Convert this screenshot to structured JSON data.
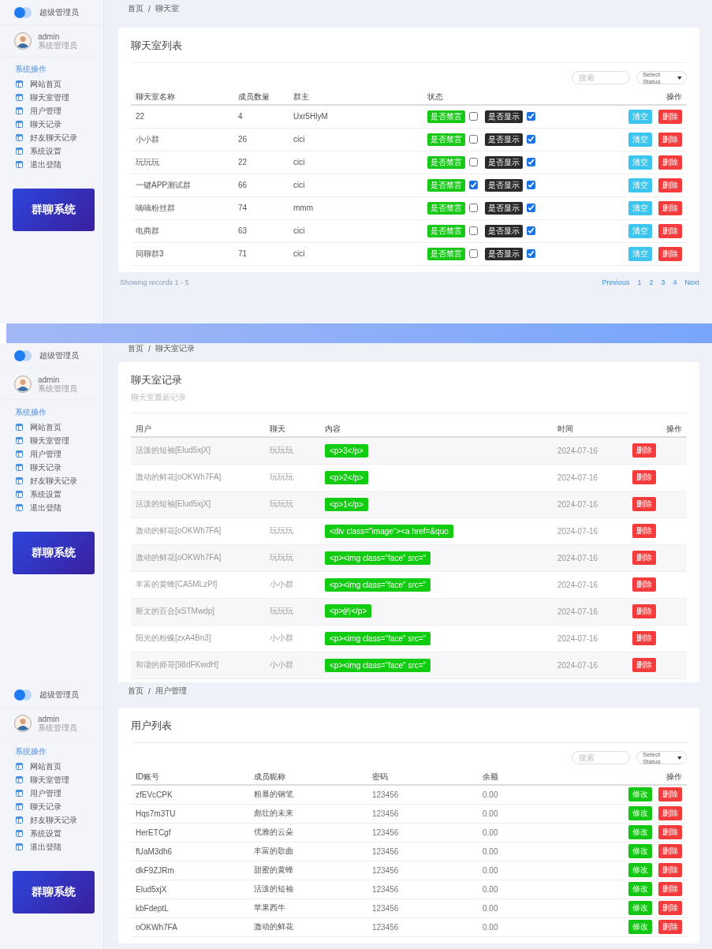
{
  "panels": [
    {
      "kind": "rooms",
      "sidebar": {
        "logo_text": "超级管理员",
        "user": {
          "name": "admin",
          "role": "系统管理员"
        },
        "section": "系统操作",
        "items": [
          "网站首页",
          "聊天室管理",
          "用户管理",
          "聊天记录",
          "好友聊天记录",
          "系统设置",
          "退出登陆"
        ],
        "banner": "群聊系统"
      },
      "breadcrumb": {
        "items": [
          "首页",
          "聊天室"
        ],
        "separator": "/"
      },
      "card": {
        "title": "聊天室列表",
        "search": {
          "placeholder": "搜索"
        },
        "select": {
          "value": "Select Status"
        },
        "columns": [
          "聊天室名称",
          "成员数量",
          "群主",
          "状态",
          "操作"
        ],
        "rows": [
          {
            "name": "22",
            "members": "4",
            "owner": "Uxr5HlyM",
            "mute_label": "是否禁言",
            "muted": false,
            "show_label": "是否显示",
            "visible": true,
            "actions": [
              "清空",
              "删除"
            ]
          },
          {
            "name": "小小群",
            "members": "26",
            "owner": "cici",
            "mute_label": "是否禁言",
            "muted": false,
            "show_label": "是否显示",
            "visible": true,
            "actions": [
              "清空",
              "删除"
            ]
          },
          {
            "name": "玩玩玩",
            "members": "22",
            "owner": "cici",
            "mute_label": "是否禁言",
            "muted": false,
            "show_label": "是否显示",
            "visible": true,
            "actions": [
              "清空",
              "删除"
            ]
          },
          {
            "name": "一键APP测试群",
            "members": "66",
            "owner": "cici",
            "mute_label": "是否禁言",
            "muted": true,
            "show_label": "是否显示",
            "visible": true,
            "actions": [
              "清空",
              "删除"
            ]
          },
          {
            "name": "嘀嘀粉丝群",
            "members": "74",
            "owner": "mmm",
            "mute_label": "是否禁言",
            "muted": false,
            "show_label": "是否显示",
            "visible": true,
            "actions": [
              "清空",
              "删除"
            ]
          },
          {
            "name": "电商群",
            "members": "63",
            "owner": "cici",
            "mute_label": "是否禁言",
            "muted": false,
            "show_label": "是否显示",
            "visible": true,
            "actions": [
              "清空",
              "删除"
            ]
          },
          {
            "name": "同聊群3",
            "members": "71",
            "owner": "cici",
            "mute_label": "是否禁言",
            "muted": false,
            "show_label": "是否显示",
            "visible": true,
            "actions": [
              "清空",
              "删除"
            ]
          }
        ]
      },
      "footer": {
        "records": "Showing records 1 - 5",
        "pagination": [
          "Previous",
          "1",
          "2",
          "3",
          "4",
          "Next"
        ]
      }
    },
    {
      "kind": "records",
      "sidebar": {
        "logo_text": "超级管理员",
        "user": {
          "name": "admin",
          "role": "系统管理员"
        },
        "section": "系统操作",
        "items": [
          "网站首页",
          "聊天室管理",
          "用户管理",
          "聊天记录",
          "好友聊天记录",
          "系统设置",
          "退出登陆"
        ],
        "banner": "群聊系统"
      },
      "breadcrumb": {
        "items": [
          "首页",
          "聊天室记录"
        ],
        "separator": "/"
      },
      "card": {
        "title": "聊天室记录",
        "subtitle": "聊天室最新记录",
        "columns": [
          "用户",
          "聊天",
          "内容",
          "时间",
          "操作"
        ],
        "rows": [
          {
            "user": "活泼的短袖[Elud5xjX]",
            "room": "玩玩玩",
            "content": "<p>3</p>",
            "time": "2024-07-16",
            "action": "删除"
          },
          {
            "user": "激动的鲜花[oOKWh7FA]",
            "room": "玩玩玩",
            "content": "<p>2</p>",
            "time": "2024-07-16",
            "action": "删除"
          },
          {
            "user": "活泼的短袖[Elud5xjX]",
            "room": "玩玩玩",
            "content": "<p>1</p>",
            "time": "2024-07-16",
            "action": "删除"
          },
          {
            "user": "激动的鲜花[oOKWh7FA]",
            "room": "玩玩玩",
            "content": "<div class=\"image\"><a href=&quo",
            "time": "2024-07-16",
            "action": "删除"
          },
          {
            "user": "激动的鲜花[oOKWh7FA]",
            "room": "玩玩玩",
            "content": "<p><img class=\"face\" src=\"",
            "time": "2024-07-16",
            "action": "删除"
          },
          {
            "user": "丰富的黄蜂[CA5MLzPf]",
            "room": "小小群",
            "content": "<p><img class=\"face\" src=\"",
            "time": "2024-07-16",
            "action": "删除"
          },
          {
            "user": "斯文的百合[xSTMwdp]",
            "room": "玩玩玩",
            "content": "<p>的</p>",
            "time": "2024-07-16",
            "action": "删除"
          },
          {
            "user": "阳光的粉蝶[zxA4Bn3]",
            "room": "小小群",
            "content": "<p><img class=\"face\" src=\"",
            "time": "2024-07-16",
            "action": "删除"
          },
          {
            "user": "和谐的师哥[98dFKwdH]",
            "room": "小小群",
            "content": "<p><img class=\"face\" src=\"",
            "time": "2024-07-16",
            "action": "删除"
          }
        ]
      }
    },
    {
      "kind": "users",
      "sidebar": {
        "logo_text": "超级管理员",
        "user": {
          "name": "admin",
          "role": "系统管理员"
        },
        "section": "系统操作",
        "items": [
          "网站首页",
          "聊天室管理",
          "用户管理",
          "聊天记录",
          "好友聊天记录",
          "系统设置",
          "退出登陆"
        ],
        "banner": "群聊系统"
      },
      "breadcrumb": {
        "items": [
          "首页",
          "用户管理"
        ],
        "separator": "/"
      },
      "card": {
        "title": "用户列表",
        "search": {
          "placeholder": "搜索"
        },
        "select": {
          "value": "Select Status"
        },
        "columns": [
          "ID账号",
          "成员昵称",
          "密码",
          "余额",
          "操作"
        ],
        "rows": [
          {
            "id": "zfEVcCPK",
            "nickname": "粗暴的钢笔",
            "password": "123456",
            "balance": "0.00",
            "actions": [
              "修改",
              "删除"
            ]
          },
          {
            "id": "Hqs7m3TU",
            "nickname": "彪壮的未来",
            "password": "123456",
            "balance": "0.00",
            "actions": [
              "修改",
              "删除"
            ]
          },
          {
            "id": "HerETCgf",
            "nickname": "优雅的云朵",
            "password": "123456",
            "balance": "0.00",
            "actions": [
              "修改",
              "删除"
            ]
          },
          {
            "id": "fUaM3dh6",
            "nickname": "丰富的歌曲",
            "password": "123456",
            "balance": "0.00",
            "actions": [
              "修改",
              "删除"
            ]
          },
          {
            "id": "dkF9ZJRm",
            "nickname": "甜蜜的黄蜂",
            "password": "123456",
            "balance": "0.00",
            "actions": [
              "修改",
              "删除"
            ]
          },
          {
            "id": "Elud5xjX",
            "nickname": "活泼的短袖",
            "password": "123456",
            "balance": "0.00",
            "actions": [
              "修改",
              "删除"
            ]
          },
          {
            "id": "kbFdeptL",
            "nickname": "苹果西牛",
            "password": "123456",
            "balance": "0.00",
            "actions": [
              "修改",
              "删除"
            ]
          },
          {
            "id": "oOKWh7FA",
            "nickname": "激动的鲜花",
            "password": "123456",
            "balance": "0.00",
            "actions": [
              "修改",
              "删除"
            ]
          }
        ]
      }
    }
  ]
}
